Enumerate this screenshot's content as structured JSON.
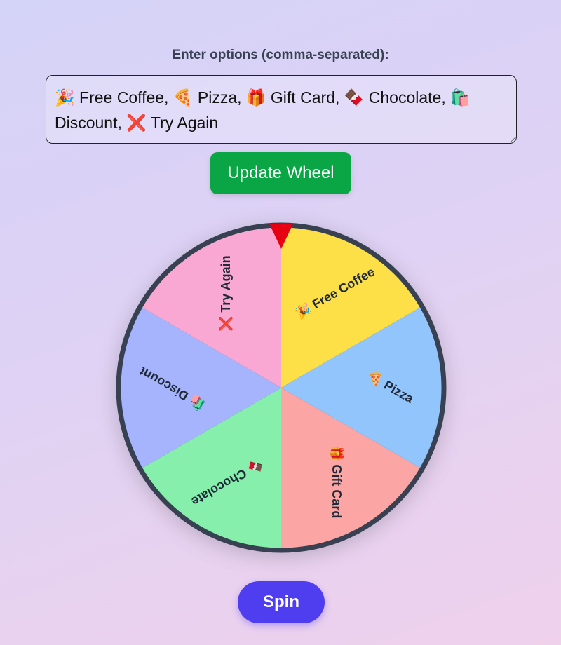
{
  "input": {
    "label": "Enter options (comma-separated):",
    "value": "🎉 Free Coffee, 🍕 Pizza, 🎁 Gift Card, 🍫 Chocolate, 🛍️ Discount, ❌ Try Again"
  },
  "buttons": {
    "update": "Update Wheel",
    "spin": "Spin"
  },
  "wheel": {
    "segments": [
      {
        "label": "🎉 Free Coffee",
        "color": "#fde047"
      },
      {
        "label": "🍕 Pizza",
        "color": "#93c5fd"
      },
      {
        "label": "🎁 Gift Card",
        "color": "#fca5a5"
      },
      {
        "label": "🍫 Chocolate",
        "color": "#86efac"
      },
      {
        "label": "🛍️ Discount",
        "color": "#a5b4fc"
      },
      {
        "label": "❌ Try Again",
        "color": "#f9a8d4"
      }
    ],
    "rim_color": "#374151",
    "pointer_color": "#e60012",
    "text_color": "#1f2937"
  }
}
